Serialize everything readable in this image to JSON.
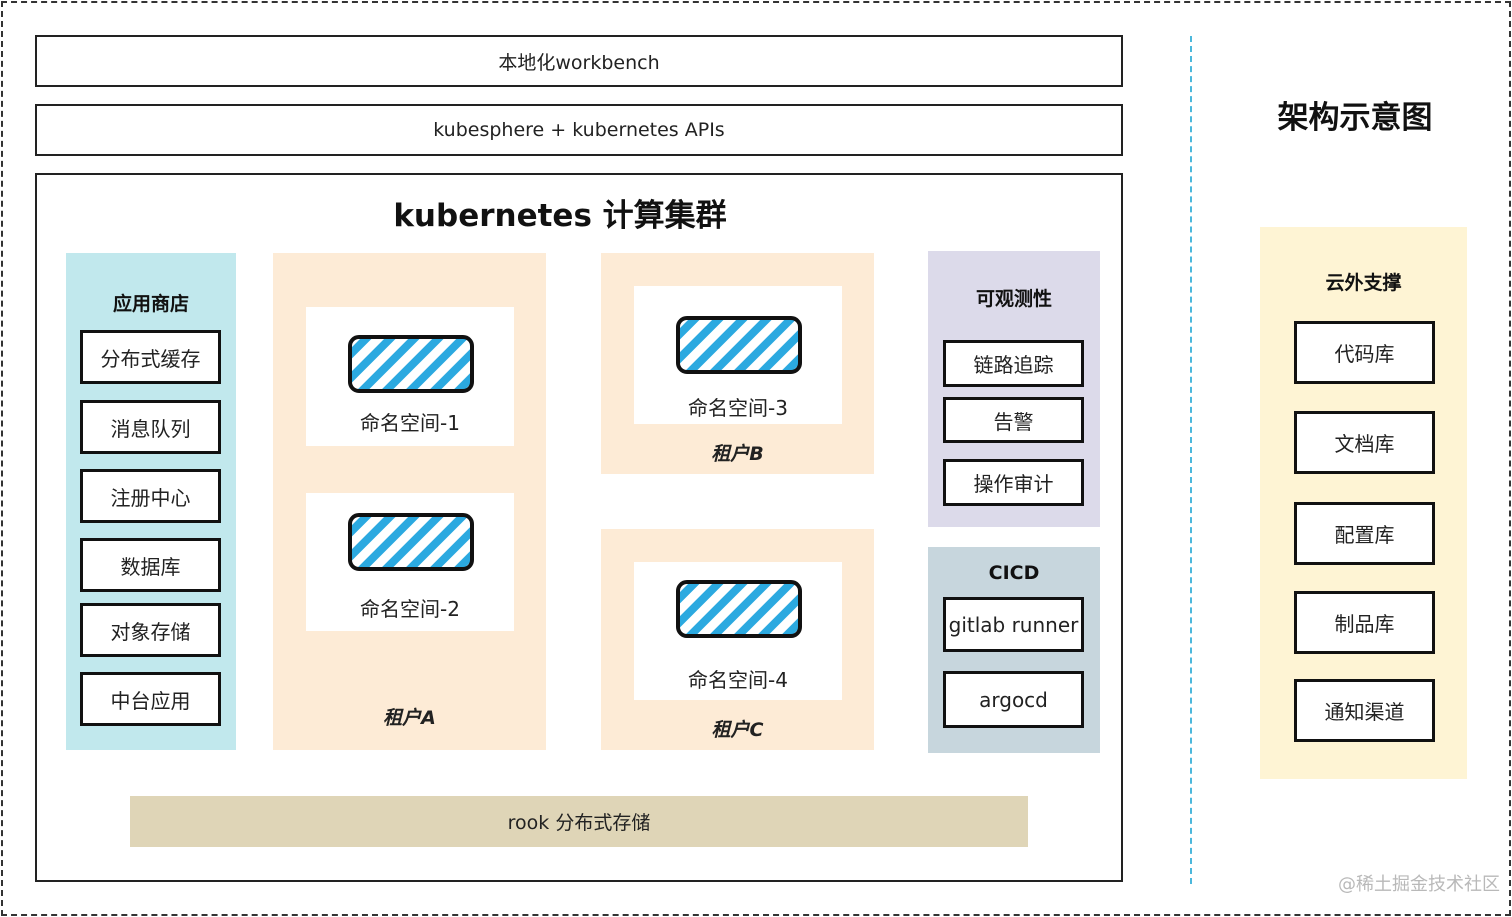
{
  "bars": {
    "workbench": "本地化workbench",
    "apis": "kubesphere + kubernetes APIs"
  },
  "cluster": {
    "title": "kubernetes 计算集群",
    "storage": "rook 分布式存储"
  },
  "app_store": {
    "title": "应用商店",
    "items": [
      "分布式缓存",
      "消息队列",
      "注册中心",
      "数据库",
      "对象存储",
      "中台应用"
    ]
  },
  "tenants": [
    {
      "label": "租户A",
      "namespaces": [
        "命名空间-1",
        "命名空间-2"
      ]
    },
    {
      "label": "租户B",
      "namespaces": [
        "命名空间-3"
      ]
    },
    {
      "label": "租户C",
      "namespaces": [
        "命名空间-4"
      ]
    }
  ],
  "observability": {
    "title": "可观测性",
    "items": [
      "链路追踪",
      "告警",
      "操作审计"
    ]
  },
  "cicd": {
    "title": "CICD",
    "items": [
      "gitlab runner",
      "argocd"
    ]
  },
  "architecture": {
    "title": "架构示意图"
  },
  "cloud_support": {
    "title": "云外支撑",
    "items": [
      "代码库",
      "文档库",
      "配置库",
      "制品库",
      "通知渠道"
    ]
  },
  "watermark": "@稀土掘金技术社区",
  "colors": {
    "app_store_bg": "#c1e8ed",
    "tenant_bg": "#fdebd6",
    "observability_bg": "#dcdaea",
    "cicd_bg": "#c7d6dd",
    "cloud_bg": "#fef4d4",
    "storage_bg": "#dfd5b7",
    "hatch_blue": "#2ba9e0"
  }
}
